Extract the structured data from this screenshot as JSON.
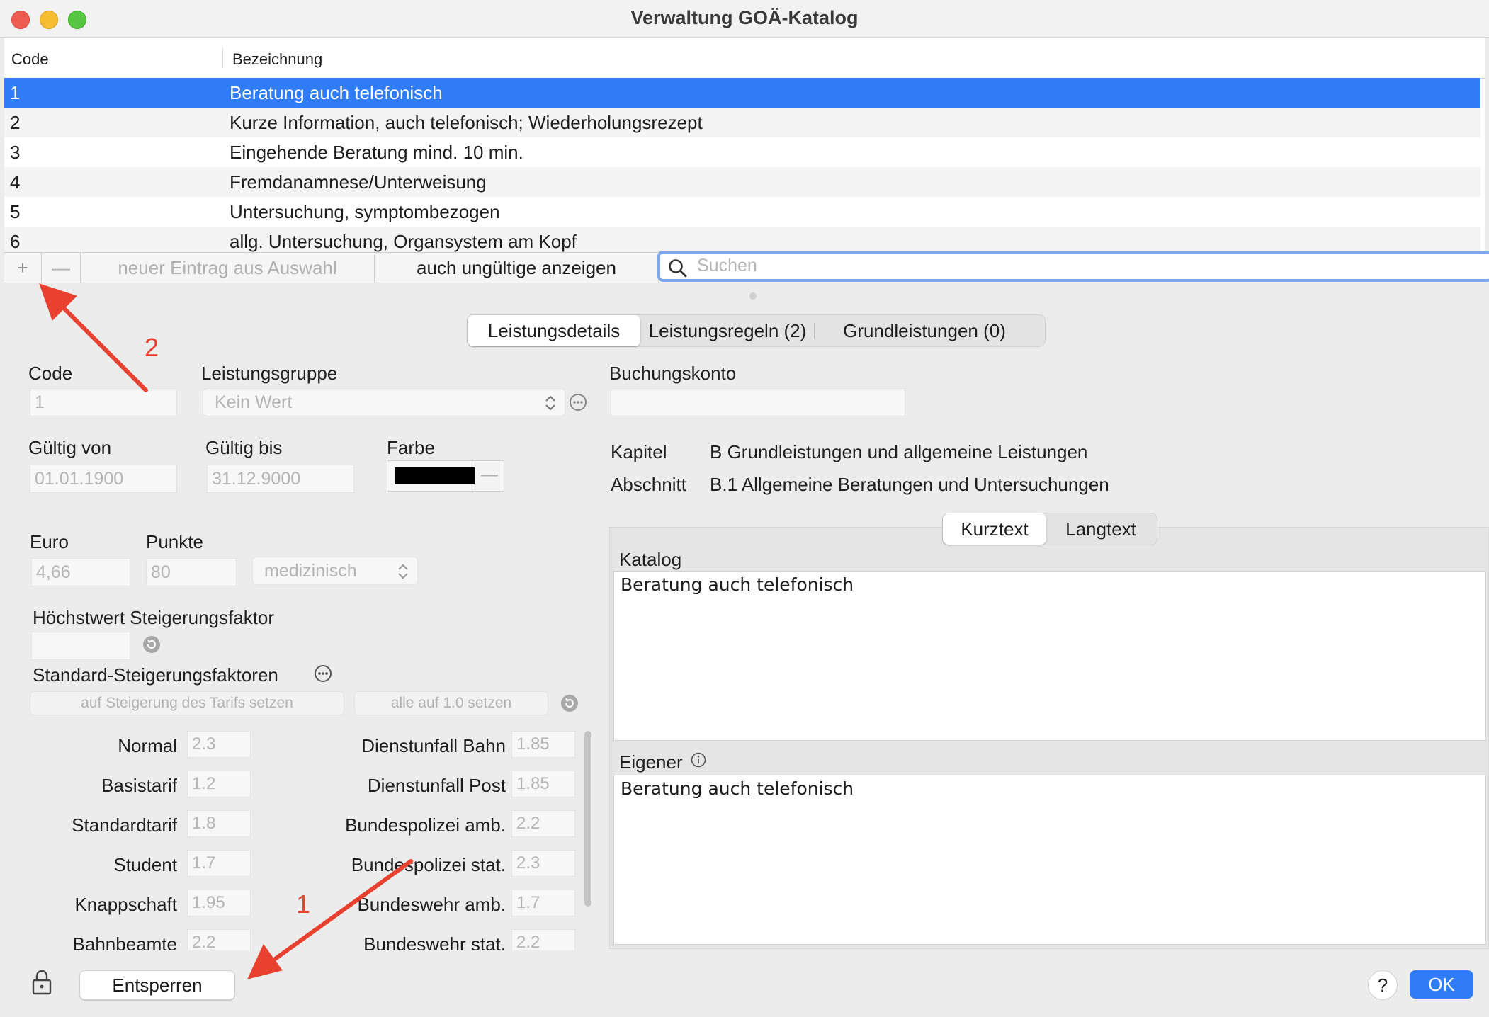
{
  "window": {
    "title": "Verwaltung GOÄ-Katalog"
  },
  "table": {
    "headers": {
      "code": "Code",
      "bezeichnung": "Bezeichnung"
    },
    "rows": [
      {
        "code": "1",
        "text": "Beratung auch telefonisch"
      },
      {
        "code": "2",
        "text": "Kurze Information, auch telefonisch; Wiederholungsrezept"
      },
      {
        "code": "3",
        "text": "Eingehende Beratung mind. 10 min."
      },
      {
        "code": "4",
        "text": "Fremdanamnese/Unterweisung"
      },
      {
        "code": "5",
        "text": "Untersuchung, symptombezogen"
      },
      {
        "code": "6",
        "text": "allg. Untersuchung, Organsystem am Kopf"
      }
    ]
  },
  "toolbar": {
    "add": "+",
    "remove": "—",
    "new_from_selection": "neuer Eintrag aus Auswahl",
    "show_invalid": "auch ungültige anzeigen",
    "search_placeholder": "Suchen"
  },
  "tabs": {
    "details": "Leistungsdetails",
    "rules": "Leistungsregeln (2)",
    "base": "Grundleistungen (0)"
  },
  "form": {
    "code_label": "Code",
    "code_value": "1",
    "group_label": "Leistungsgruppe",
    "group_value": "Kein Wert",
    "account_label": "Buchungskonto",
    "valid_from_label": "Gültig von",
    "valid_from": "01.01.1900",
    "valid_to_label": "Gültig bis",
    "valid_to": "31.12.9000",
    "color_label": "Farbe",
    "color_value": "#000000",
    "euro_label": "Euro",
    "euro_value": "4,66",
    "points_label": "Punkte",
    "points_value": "80",
    "type_value": "medizinisch",
    "max_factor_label": "Höchstwert Steigerungsfaktor",
    "std_factors_label": "Standard-Steigerungsfaktoren",
    "btn_tariff": "auf Steigerung des Tarifs setzen",
    "btn_all_one": "alle auf 1.0 setzen",
    "factors_left": [
      {
        "label": "Normal",
        "value": "2.3"
      },
      {
        "label": "Basistarif",
        "value": "1.2"
      },
      {
        "label": "Standardtarif",
        "value": "1.8"
      },
      {
        "label": "Student",
        "value": "1.7"
      },
      {
        "label": "Knappschaft",
        "value": "1.95"
      },
      {
        "label": "Bahnbeamte",
        "value": "2.2"
      }
    ],
    "factors_right": [
      {
        "label": "Dienstunfall Bahn",
        "value": "1.85"
      },
      {
        "label": "Dienstunfall Post",
        "value": "1.85"
      },
      {
        "label": "Bundespolizei amb.",
        "value": "2.2"
      },
      {
        "label": "Bundespolizei stat.",
        "value": "2.3"
      },
      {
        "label": "Bundeswehr amb.",
        "value": "1.7"
      },
      {
        "label": "Bundeswehr stat.",
        "value": "2.2"
      }
    ]
  },
  "info": {
    "kapitel_label": "Kapitel",
    "kapitel_value": "B Grundleistungen und allgemeine Leistungen",
    "abschnitt_label": "Abschnitt",
    "abschnitt_value": "B.1 Allgemeine Beratungen und Untersuchungen"
  },
  "text_tabs": {
    "short": "Kurztext",
    "long": "Langtext"
  },
  "texts": {
    "katalog_label": "Katalog",
    "katalog_value": "Beratung auch telefonisch",
    "eigener_label": "Eigener",
    "eigener_value": "Beratung auch telefonisch"
  },
  "bottom": {
    "unlock": "Entsperren",
    "help": "?",
    "ok": "OK"
  },
  "annotations": {
    "a1": "1",
    "a2": "2"
  },
  "colors": {
    "accent": "#2f7cf6",
    "annotation": "#e8412f",
    "close": "#ee5b50",
    "minimize": "#f5bd2f",
    "zoom": "#55c63f"
  },
  "icons": [
    "search-icon",
    "lock-icon",
    "info-icon",
    "more-icon",
    "reset-icon",
    "chevron-updown-icon"
  ]
}
